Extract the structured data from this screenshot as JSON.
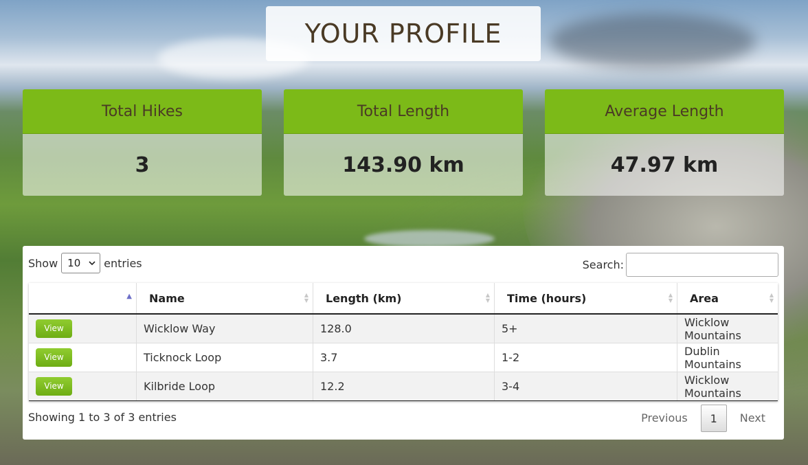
{
  "page_title": "YOUR PROFILE",
  "stats": [
    {
      "label": "Total Hikes",
      "value": "3"
    },
    {
      "label": "Total Length",
      "value": "143.90 km"
    },
    {
      "label": "Average Length",
      "value": "47.97 km"
    }
  ],
  "table_controls": {
    "show_label": "Show",
    "entries_value": "10",
    "entries_label": "entries",
    "search_label": "Search:",
    "search_value": ""
  },
  "table": {
    "headers": [
      "",
      "Name",
      "Length (km)",
      "Time (hours)",
      "Area"
    ],
    "rows": [
      {
        "action": "View",
        "name": "Wicklow Way",
        "length": "128.0",
        "time": "5+",
        "area": "Wicklow Mountains"
      },
      {
        "action": "View",
        "name": "Ticknock Loop",
        "length": "3.7",
        "time": "1-2",
        "area": "Dublin Mountains"
      },
      {
        "action": "View",
        "name": "Kilbride Loop",
        "length": "12.2",
        "time": "3-4",
        "area": "Wicklow Mountains"
      }
    ]
  },
  "footer": {
    "info": "Showing 1 to 3 of 3 entries",
    "previous": "Previous",
    "current_page": "1",
    "next": "Next"
  },
  "colors": {
    "accent_green": "#7cba18",
    "title_text": "#4a3a25"
  }
}
